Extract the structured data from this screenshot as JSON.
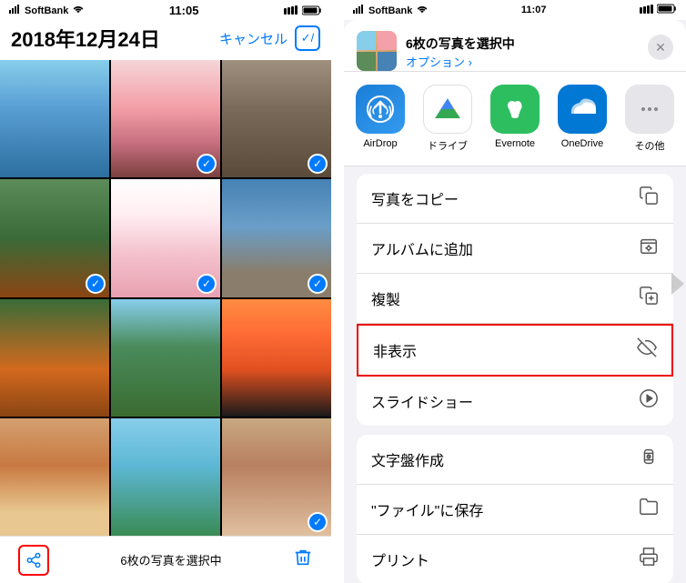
{
  "left": {
    "statusBar": {
      "carrier": "SoftBank",
      "wifiIcon": "wifi",
      "time": "11:05",
      "batteryIcon": "battery"
    },
    "header": {
      "date": "2018年12月24日",
      "cancelLabel": "キャンセル",
      "selectIcon": "✓/"
    },
    "photos": [
      {
        "id": 1,
        "checked": false,
        "cellClass": "cell-1"
      },
      {
        "id": 2,
        "checked": true,
        "cellClass": "cell-2"
      },
      {
        "id": 3,
        "checked": true,
        "cellClass": "cell-3"
      },
      {
        "id": 4,
        "checked": false,
        "cellClass": "cell-4"
      },
      {
        "id": 5,
        "checked": true,
        "cellClass": "cell-5"
      },
      {
        "id": 6,
        "checked": true,
        "cellClass": "cell-6"
      },
      {
        "id": 7,
        "checked": false,
        "cellClass": "cell-7"
      },
      {
        "id": 8,
        "checked": false,
        "cellClass": "cell-8"
      },
      {
        "id": 9,
        "checked": false,
        "cellClass": "cell-9"
      },
      {
        "id": 10,
        "checked": false,
        "cellClass": "cell-10"
      },
      {
        "id": 11,
        "checked": false,
        "cellClass": "cell-11"
      },
      {
        "id": 12,
        "checked": true,
        "cellClass": "cell-12"
      }
    ],
    "bottomBar": {
      "countLabel": "6枚の写真を選択中",
      "shareIcon": "share",
      "trashIcon": "trash"
    }
  },
  "right": {
    "statusBar": {
      "carrier": "SoftBank",
      "wifiIcon": "wifi",
      "time": "11:07",
      "batteryIcon": "battery"
    },
    "shareSheet": {
      "title": "6枚の写真を選択中",
      "optionsLabel": "オプション ›",
      "closeLabel": "✕",
      "appIcons": [
        {
          "id": "airdrop",
          "label": "AirDrop",
          "iconType": "airdrop"
        },
        {
          "id": "drive",
          "label": "ドライブ",
          "iconType": "drive"
        },
        {
          "id": "evernote",
          "label": "Evernote",
          "iconType": "evernote"
        },
        {
          "id": "onedrive",
          "label": "OneDrive",
          "iconType": "onedrive"
        }
      ],
      "actions": [
        {
          "id": "copy-photo",
          "label": "写真をコピー",
          "icon": "copy",
          "highlighted": false
        },
        {
          "id": "add-album",
          "label": "アルバムに追加",
          "icon": "album",
          "highlighted": false
        },
        {
          "id": "duplicate",
          "label": "複製",
          "icon": "duplicate",
          "highlighted": false
        },
        {
          "id": "hide",
          "label": "非表示",
          "icon": "hide",
          "highlighted": true
        },
        {
          "id": "slideshow",
          "label": "スライドショー",
          "icon": "play",
          "highlighted": false
        },
        {
          "id": "watch-face",
          "label": "文字盤作成",
          "icon": "watch",
          "highlighted": false
        },
        {
          "id": "save-files",
          "label": "\"ファイル\"に保存",
          "icon": "folder",
          "highlighted": false
        },
        {
          "id": "print",
          "label": "プリント",
          "icon": "print",
          "highlighted": false
        }
      ]
    }
  }
}
